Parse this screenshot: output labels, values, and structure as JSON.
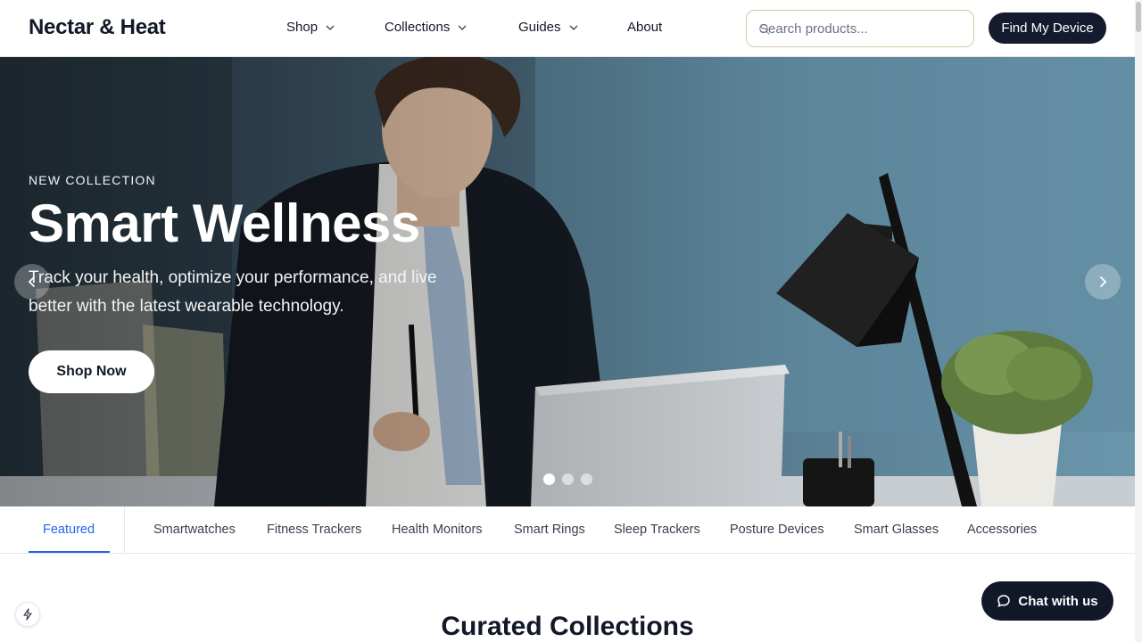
{
  "header": {
    "logo": "Nectar & Heat",
    "nav": [
      {
        "label": "Shop",
        "has_dropdown": true
      },
      {
        "label": "Collections",
        "has_dropdown": true
      },
      {
        "label": "Guides",
        "has_dropdown": true
      },
      {
        "label": "About",
        "has_dropdown": false
      }
    ],
    "search_placeholder": "Search products...",
    "search_icon": "search-icon",
    "cta_label": "Find My Device"
  },
  "hero": {
    "eyebrow": "NEW COLLECTION",
    "title": "Smart Wellness",
    "subtitle": "Track your health, optimize your performance, and live better with the latest wearable technology.",
    "button_label": "Shop Now",
    "slides_total": 3,
    "active_slide": 1,
    "prev_icon": "chevron-left-icon",
    "next_icon": "chevron-right-icon"
  },
  "tabs": {
    "items": [
      {
        "label": "Featured",
        "active": true
      },
      {
        "label": "Smartwatches",
        "active": false
      },
      {
        "label": "Fitness Trackers",
        "active": false
      },
      {
        "label": "Health Monitors",
        "active": false
      },
      {
        "label": "Smart Rings",
        "active": false
      },
      {
        "label": "Sleep Trackers",
        "active": false
      },
      {
        "label": "Posture Devices",
        "active": false
      },
      {
        "label": "Smart Glasses",
        "active": false
      },
      {
        "label": "Accessories",
        "active": false
      }
    ]
  },
  "section": {
    "title": "Curated Collections"
  },
  "floating": {
    "chat_label": "Chat with us",
    "chat_icon": "message-circle-icon",
    "bolt_icon": "lightning-icon"
  },
  "colors": {
    "brand_dark": "#151b2e",
    "accent_blue": "#2563eb",
    "search_border": "#d6c8a8"
  }
}
